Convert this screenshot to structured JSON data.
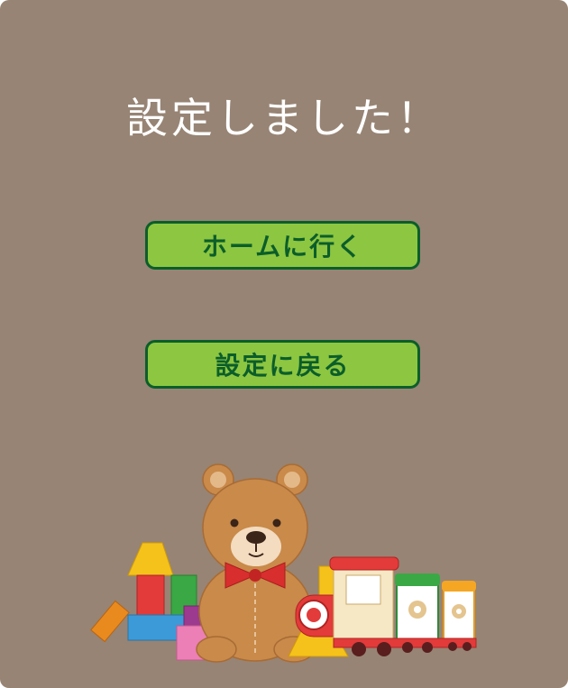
{
  "title": "設定しました！",
  "buttons": {
    "home_label": "ホームに行く",
    "back_label": "設定に戻る"
  },
  "colors": {
    "background": "#978474",
    "button_fill": "#8dc640",
    "button_border": "#0b5e2a",
    "title_text": "#ffffff"
  },
  "illustration": {
    "items": [
      "teddy-bear",
      "toy-blocks",
      "toy-train"
    ]
  }
}
